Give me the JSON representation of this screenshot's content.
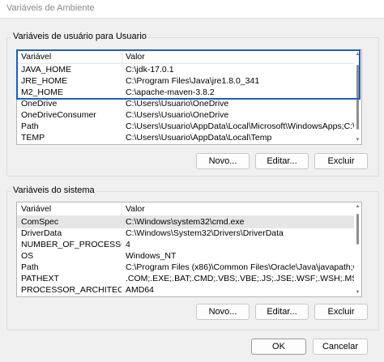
{
  "window": {
    "title": "Variáveis de Ambiente"
  },
  "user_vars": {
    "group_label": "Variáveis de usuário para Usuario",
    "columns": [
      "Variável",
      "Valor"
    ],
    "rows": [
      {
        "name": "JAVA_HOME",
        "value": "C:\\jdk-17.0.1"
      },
      {
        "name": "JRE_HOME",
        "value": "C:\\Program Files\\Java\\jre1.8.0_341"
      },
      {
        "name": "M2_HOME",
        "value": "C:\\apache-maven-3.8.2"
      },
      {
        "name": "OneDrive",
        "value": "C:\\Users\\Usuario\\OneDrive"
      },
      {
        "name": "OneDriveConsumer",
        "value": "C:\\Users\\Usuario\\OneDrive"
      },
      {
        "name": "Path",
        "value": "C:\\Users\\Usuario\\AppData\\Local\\Microsoft\\WindowsApps;C:\\Prog..."
      },
      {
        "name": "TEMP",
        "value": "C:\\Users\\Usuario\\AppData\\Local\\Temp"
      }
    ],
    "buttons": {
      "new": "Novo...",
      "edit": "Editar...",
      "delete": "Excluir"
    }
  },
  "system_vars": {
    "group_label": "Variáveis do sistema",
    "columns": [
      "Variável",
      "Valor"
    ],
    "rows": [
      {
        "name": "ComSpec",
        "value": "C:\\Windows\\system32\\cmd.exe"
      },
      {
        "name": "DriverData",
        "value": "C:\\Windows\\System32\\Drivers\\DriverData"
      },
      {
        "name": "NUMBER_OF_PROCESSORS",
        "value": "4"
      },
      {
        "name": "OS",
        "value": "Windows_NT"
      },
      {
        "name": "Path",
        "value": "C:\\Program Files (x86)\\Common Files\\Oracle\\Java\\javapath;C:\\Win..."
      },
      {
        "name": "PATHEXT",
        "value": ".COM;.EXE;.BAT;.CMD;.VBS;.VBE;.JS;.JSE;.WSF;.WSH;.MSC"
      },
      {
        "name": "PROCESSOR_ARCHITECTURE",
        "value": "AMD64"
      }
    ],
    "buttons": {
      "new": "Novo...",
      "edit": "Editar...",
      "delete": "Excluir"
    }
  },
  "footer": {
    "ok": "OK",
    "cancel": "Cancelar"
  },
  "colors": {
    "highlight": "#1f5fb8",
    "selected_row": "#e6e6e6"
  }
}
